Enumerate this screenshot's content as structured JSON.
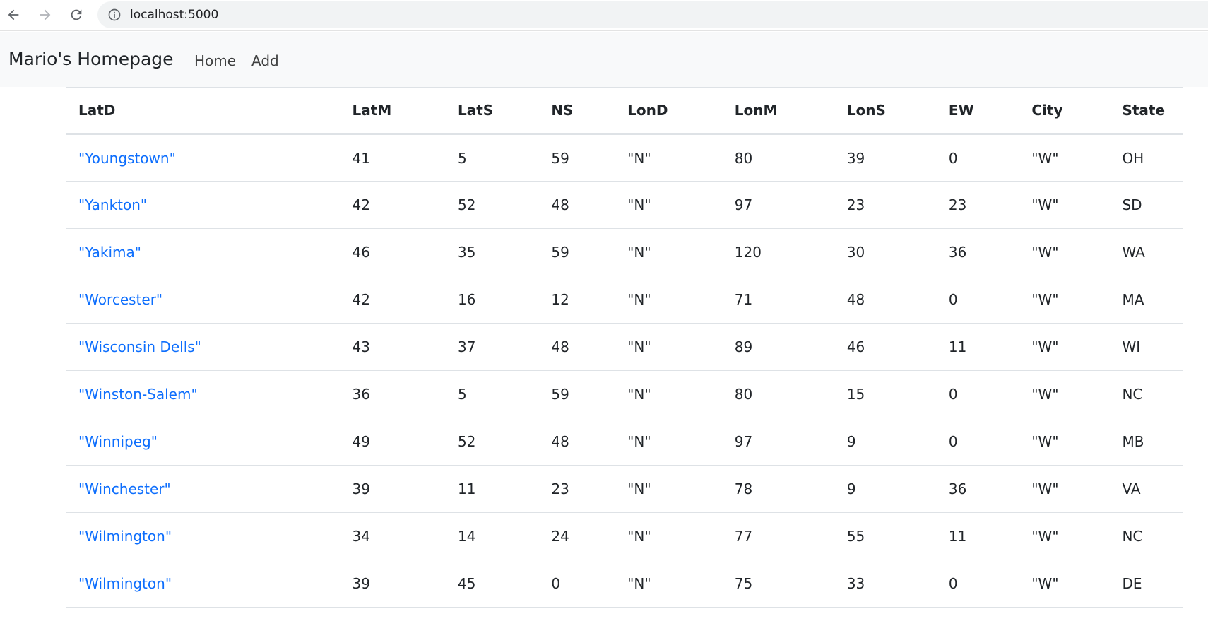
{
  "browser": {
    "url": "localhost:5000"
  },
  "navbar": {
    "brand": "Mario's Homepage",
    "links": [
      "Home",
      "Add"
    ]
  },
  "table": {
    "headers": [
      "LatD",
      "LatM",
      "LatS",
      "NS",
      "LonD",
      "LonM",
      "LonS",
      "EW",
      "City",
      "State"
    ],
    "rows": [
      [
        "\"Youngstown\"",
        "41",
        "5",
        "59",
        "\"N\"",
        "80",
        "39",
        "0",
        "\"W\"",
        "OH"
      ],
      [
        "\"Yankton\"",
        "42",
        "52",
        "48",
        "\"N\"",
        "97",
        "23",
        "23",
        "\"W\"",
        "SD"
      ],
      [
        "\"Yakima\"",
        "46",
        "35",
        "59",
        "\"N\"",
        "120",
        "30",
        "36",
        "\"W\"",
        "WA"
      ],
      [
        "\"Worcester\"",
        "42",
        "16",
        "12",
        "\"N\"",
        "71",
        "48",
        "0",
        "\"W\"",
        "MA"
      ],
      [
        "\"Wisconsin Dells\"",
        "43",
        "37",
        "48",
        "\"N\"",
        "89",
        "46",
        "11",
        "\"W\"",
        "WI"
      ],
      [
        "\"Winston-Salem\"",
        "36",
        "5",
        "59",
        "\"N\"",
        "80",
        "15",
        "0",
        "\"W\"",
        "NC"
      ],
      [
        "\"Winnipeg\"",
        "49",
        "52",
        "48",
        "\"N\"",
        "97",
        "9",
        "0",
        "\"W\"",
        "MB"
      ],
      [
        "\"Winchester\"",
        "39",
        "11",
        "23",
        "\"N\"",
        "78",
        "9",
        "36",
        "\"W\"",
        "VA"
      ],
      [
        "\"Wilmington\"",
        "34",
        "14",
        "24",
        "\"N\"",
        "77",
        "55",
        "11",
        "\"W\"",
        "NC"
      ],
      [
        "\"Wilmington\"",
        "39",
        "45",
        "0",
        "\"N\"",
        "75",
        "33",
        "0",
        "\"W\"",
        "DE"
      ]
    ]
  }
}
